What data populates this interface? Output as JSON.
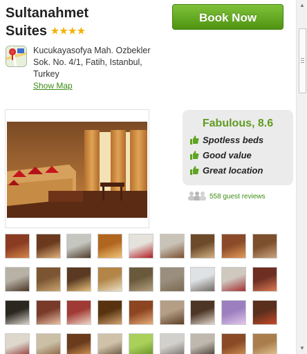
{
  "hotel": {
    "name_line1": "Sultanahmet",
    "name_line2": "Suites",
    "stars": "★★★★",
    "book_label": "Book Now",
    "address": "Kucukayasofya Mah. Ozbekler Sok. No. 4/1, Fatih, Istanbul, Turkey",
    "show_map": "Show Map"
  },
  "rating": {
    "title": "Fabulous, 8.6",
    "positives": [
      "Spotless beds",
      "Good value",
      "Great location"
    ],
    "reviews": "558 guest reviews"
  },
  "thumbnails_count": 36,
  "colors": {
    "accent_green": "#5f9b1e",
    "button_green": "#5fa421",
    "link_green": "#3d8c13",
    "stars": "#f2b200"
  },
  "icons": [
    "map-app-icon",
    "thumbs-up-icon",
    "guest-people-icon"
  ]
}
